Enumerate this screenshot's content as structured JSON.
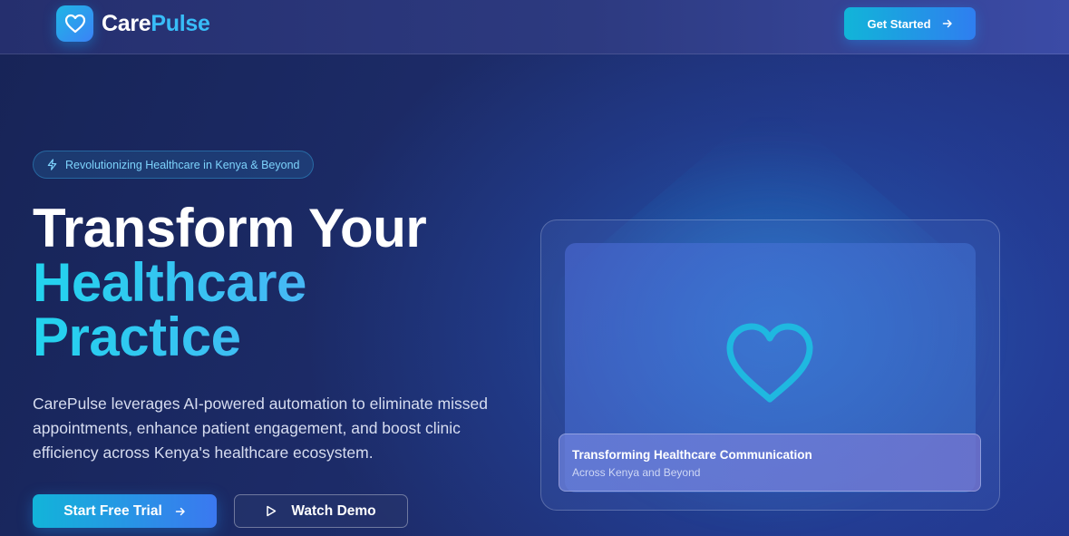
{
  "nav": {
    "brand_part1": "Care",
    "brand_part2": "Pulse",
    "logo_icon": "heart-icon",
    "cta_label": "Get Started",
    "cta_icon": "arrow-right-icon"
  },
  "hero": {
    "badge_icon": "lightning-icon",
    "badge_text": "Revolutionizing Healthcare in Kenya & Beyond",
    "headline_line1": "Transform Your",
    "headline_line2": "Healthcare",
    "headline_line3": "Practice",
    "description": "CarePulse leverages AI-powered automation to eliminate missed appointments, enhance patient engagement, and boost clinic efficiency across Kenya's healthcare ecosystem.",
    "primary_button": "Start Free Trial",
    "secondary_button": "Watch Demo"
  },
  "card": {
    "icon": "heart-icon",
    "caption_title": "Transforming Healthcare Communication",
    "caption_subtitle": "Across Kenya and Beyond"
  },
  "colors": {
    "accent_cyan": "#22d3ee",
    "accent_blue": "#3b82f6",
    "background": "#1c2a66"
  }
}
